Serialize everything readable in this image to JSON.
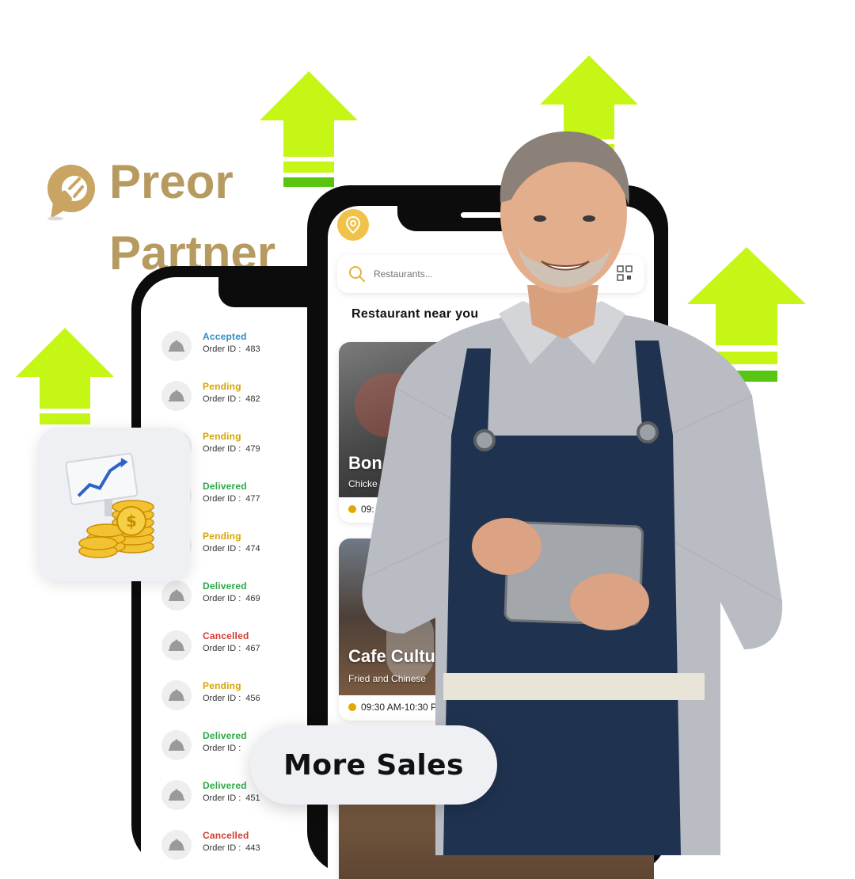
{
  "brand": {
    "line1": "Preor",
    "line2": "Partner",
    "color": "#b69a5f"
  },
  "orders": [
    {
      "status": "Accepted",
      "label": "Order ID :",
      "id": "483",
      "color": "#2b8fc7"
    },
    {
      "status": "Pending",
      "label": "Order ID :",
      "id": "482",
      "color": "#d6a400"
    },
    {
      "status": "Pending",
      "label": "Order ID :",
      "id": "479",
      "color": "#d6a400"
    },
    {
      "status": "Delivered",
      "label": "Order ID :",
      "id": "477",
      "color": "#2aa844"
    },
    {
      "status": "Pending",
      "label": "Order ID :",
      "id": "474",
      "color": "#d6a400"
    },
    {
      "status": "Delivered",
      "label": "Order ID :",
      "id": "469",
      "color": "#2aa844"
    },
    {
      "status": "Cancelled",
      "label": "Order ID :",
      "id": "467",
      "color": "#d43a2f"
    },
    {
      "status": "Pending",
      "label": "Order ID :",
      "id": "456",
      "color": "#d6a400"
    },
    {
      "status": "Delivered",
      "label": "Order ID :",
      "id": "",
      "color": "#2aa844"
    },
    {
      "status": "Delivered",
      "label": "Order ID :",
      "id": "451",
      "color": "#2aa844"
    },
    {
      "status": "Cancelled",
      "label": "Order ID :",
      "id": "443",
      "color": "#d43a2f"
    }
  ],
  "search": {
    "placeholder": "Restaurants..."
  },
  "section_title": "Restaurant near you",
  "restaurants": [
    {
      "name": "Bon",
      "type": "Chicke",
      "time": "09:"
    },
    {
      "name": "Cafe Cultu",
      "type": "Fried and Chinese",
      "time": "09:30 AM-10:30 P"
    }
  ],
  "cta": {
    "label": "More Sales"
  },
  "colors": {
    "arrow_lime": "#c6f616",
    "arrow_green": "#58c610",
    "gold": "#e3b23c"
  }
}
